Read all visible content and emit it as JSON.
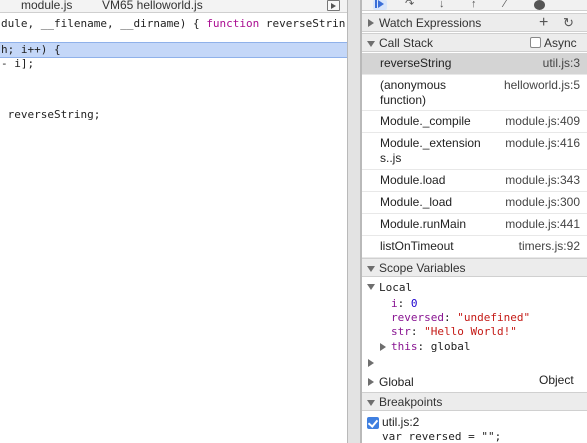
{
  "editor": {
    "tabs": [
      "module.js",
      "VM65 helloworld.js"
    ],
    "lines": [
      {
        "pre": "dule, __filename, __dirname) { ",
        "kw": "function",
        "post": " reverseStrin"
      },
      {
        "text": "h; i++) {"
      },
      {
        "text": "- i];"
      },
      {
        "text": " reverseString;"
      }
    ]
  },
  "watch": {
    "title": "Watch Expressions",
    "add_icon": "+",
    "refresh_icon": "↻"
  },
  "callstack": {
    "title": "Call Stack",
    "async_label": "Async",
    "frames": [
      {
        "name": "reverseString",
        "location": "util.js:3",
        "selected": true
      },
      {
        "name": "(anonymous function)",
        "location": "helloworld.js:5"
      },
      {
        "name": "Module._compile",
        "location": "module.js:409"
      },
      {
        "name": "Module._extensions..js",
        "location": "module.js:416"
      },
      {
        "name": "Module.load",
        "location": "module.js:343"
      },
      {
        "name": "Module._load",
        "location": "module.js:300"
      },
      {
        "name": "Module.runMain",
        "location": "module.js:441"
      },
      {
        "name": "listOnTimeout",
        "location": "timers.js:92"
      }
    ]
  },
  "scope": {
    "title": "Scope Variables",
    "local_label": "Local",
    "vars": [
      {
        "name": "i",
        "value": "0"
      },
      {
        "name": "reversed",
        "value": "\"undefined\""
      },
      {
        "name": "str",
        "value": "\"Hello World!\""
      },
      {
        "name": "this",
        "value": "global"
      }
    ],
    "global_label": "Global",
    "global_value": "Object"
  },
  "breakpoints": {
    "title": "Breakpoints",
    "items": [
      {
        "location": "util.js:2",
        "snippet": "var reversed = \"\";",
        "checked": true
      }
    ]
  },
  "colors": {
    "highlight": "#c4d7f8",
    "selected_frame": "#d4d4d4",
    "keyword": "#aa0d91",
    "string": "#c41a16",
    "number": "#1c00cf",
    "property": "#881391",
    "checkbox": "#3f7fe0"
  }
}
